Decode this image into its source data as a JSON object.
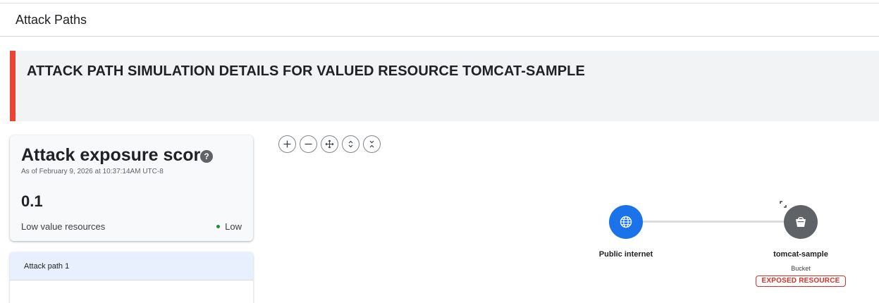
{
  "header": {
    "title": "Attack Paths"
  },
  "banner": {
    "title": "ATTACK PATH SIMULATION DETAILS FOR VALUED RESOURCE TOMCAT-SAMPLE",
    "accent_color": "#ea4335"
  },
  "score_card": {
    "title": "Attack exposure score",
    "help_icon": "?",
    "as_of": "As of February 9, 2026 at 10:37:14AM UTC-8",
    "value": "0.1",
    "resources_label": "Low value resources",
    "level": "Low",
    "level_color": "#1e8e3e"
  },
  "paths": [
    {
      "label": "Attack path 1"
    }
  ],
  "graph_controls": [
    "zoom-in-icon",
    "zoom-out-icon",
    "move-icon",
    "expand-vertical-icon",
    "collapse-vertical-icon"
  ],
  "graph": {
    "nodes": [
      {
        "name": "Public internet",
        "icon": "globe-icon",
        "color": "#1a73e8"
      },
      {
        "name": "tomcat-sample",
        "type": "Bucket",
        "icon": "bucket-icon",
        "color": "#5f6368",
        "badge": "EXPOSED RESOURCE"
      }
    ]
  }
}
